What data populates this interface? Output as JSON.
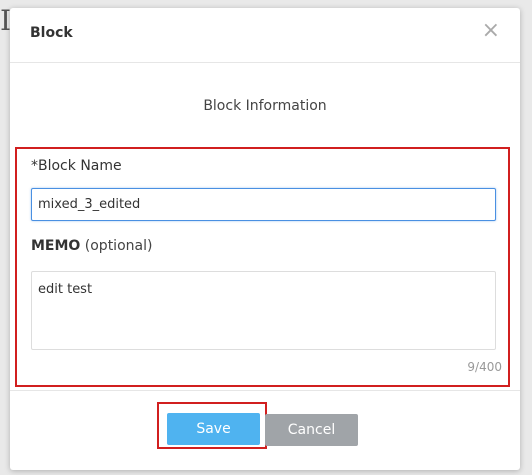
{
  "modal": {
    "title": "Block",
    "close_symbol": "×"
  },
  "section_title": "Block Information",
  "form": {
    "name_label": "*Block Name",
    "name_value": "mixed_3_edited",
    "memo_label": "MEMO",
    "memo_optional": "(optional)",
    "memo_value": "edit test",
    "memo_counter": "9/400"
  },
  "footer": {
    "save_label": "Save",
    "cancel_label": "Cancel"
  },
  "colors": {
    "highlight_border": "#d11f1f",
    "save_button": "#4fb3f0",
    "cancel_button": "#a0a4a8",
    "input_focus": "#4a90e2"
  },
  "icons": {
    "close": "close-icon"
  }
}
